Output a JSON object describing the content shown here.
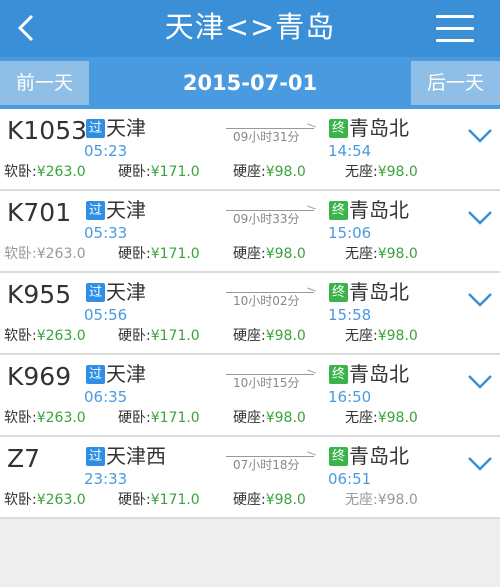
{
  "header": {
    "title": "天津<>青岛"
  },
  "date_bar": {
    "prev_label": "前一天",
    "date": "2015-07-01",
    "next_label": "后一天"
  },
  "trains": [
    {
      "number": "K1053",
      "pass_badge": "过",
      "from": "天津",
      "dep_time": "05:23",
      "duration": "09小时31分",
      "end_badge": "终",
      "to": "青岛北",
      "arr_time": "14:54",
      "prices": [
        {
          "label": "软卧:",
          "value": "¥263.0",
          "available": true
        },
        {
          "label": "硬卧:",
          "value": "¥171.0",
          "available": true
        },
        {
          "label": "硬座:",
          "value": "¥98.0",
          "available": true
        },
        {
          "label": "无座:",
          "value": "¥98.0",
          "available": true
        }
      ]
    },
    {
      "number": "K701",
      "pass_badge": "过",
      "from": "天津",
      "dep_time": "05:33",
      "duration": "09小时33分",
      "end_badge": "终",
      "to": "青岛北",
      "arr_time": "15:06",
      "prices": [
        {
          "label": "软卧:",
          "value": "¥263.0",
          "available": false
        },
        {
          "label": "硬卧:",
          "value": "¥171.0",
          "available": true
        },
        {
          "label": "硬座:",
          "value": "¥98.0",
          "available": true
        },
        {
          "label": "无座:",
          "value": "¥98.0",
          "available": true
        }
      ]
    },
    {
      "number": "K955",
      "pass_badge": "过",
      "from": "天津",
      "dep_time": "05:56",
      "duration": "10小时02分",
      "end_badge": "终",
      "to": "青岛北",
      "arr_time": "15:58",
      "prices": [
        {
          "label": "软卧:",
          "value": "¥263.0",
          "available": true
        },
        {
          "label": "硬卧:",
          "value": "¥171.0",
          "available": true
        },
        {
          "label": "硬座:",
          "value": "¥98.0",
          "available": true
        },
        {
          "label": "无座:",
          "value": "¥98.0",
          "available": true
        }
      ]
    },
    {
      "number": "K969",
      "pass_badge": "过",
      "from": "天津",
      "dep_time": "06:35",
      "duration": "10小时15分",
      "end_badge": "终",
      "to": "青岛北",
      "arr_time": "16:50",
      "prices": [
        {
          "label": "软卧:",
          "value": "¥263.0",
          "available": true
        },
        {
          "label": "硬卧:",
          "value": "¥171.0",
          "available": true
        },
        {
          "label": "硬座:",
          "value": "¥98.0",
          "available": true
        },
        {
          "label": "无座:",
          "value": "¥98.0",
          "available": true
        }
      ]
    },
    {
      "number": "Z7",
      "pass_badge": "过",
      "from": "天津西",
      "dep_time": "23:33",
      "duration": "07小时18分",
      "end_badge": "终",
      "to": "青岛北",
      "arr_time": "06:51",
      "prices": [
        {
          "label": "软卧:",
          "value": "¥263.0",
          "available": true
        },
        {
          "label": "硬卧:",
          "value": "¥171.0",
          "available": true
        },
        {
          "label": "硬座:",
          "value": "¥98.0",
          "available": true
        },
        {
          "label": "无座:",
          "value": "¥98.0",
          "available": false
        }
      ]
    }
  ],
  "icons": {
    "back": "chevron-left-icon",
    "menu": "menu-icon",
    "expand": "chevron-down-icon"
  },
  "colors": {
    "header": "#3b8fd6",
    "date_bar": "#4a9ae0",
    "price_available": "#3aa33a",
    "price_unavailable": "#9a9a9a",
    "pass_badge": "#2f8ee6",
    "end_badge": "#3ab34a"
  }
}
